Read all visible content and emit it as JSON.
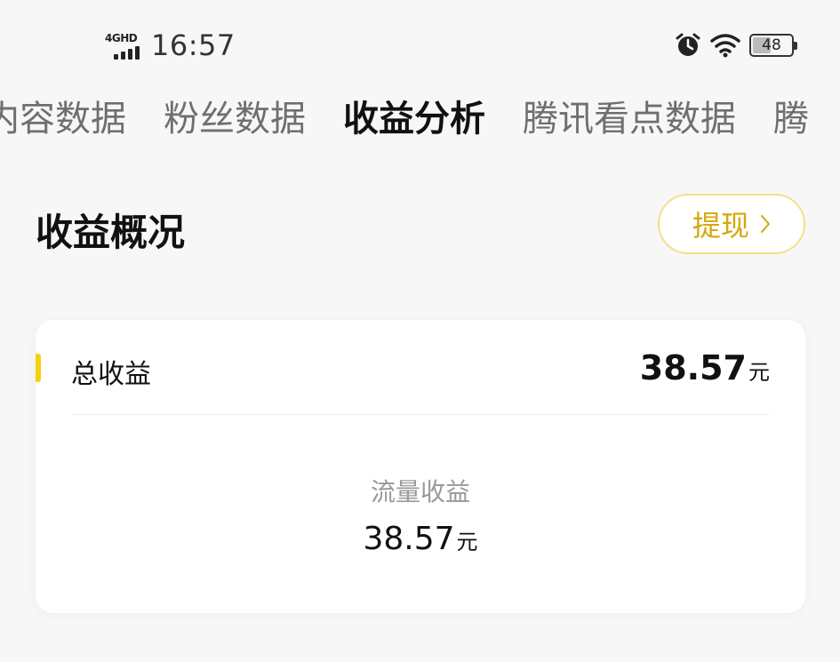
{
  "status_bar": {
    "network": "4GHD",
    "time": "16:57",
    "battery": "48",
    "battery_level": 0.48,
    "icons": [
      "signal-icon",
      "alarm-icon",
      "wifi-icon",
      "battery-icon"
    ]
  },
  "tabs": [
    {
      "label": "内容数据",
      "active": false
    },
    {
      "label": "粉丝数据",
      "active": false
    },
    {
      "label": "收益分析",
      "active": true
    },
    {
      "label": "腾讯看点数据",
      "active": false
    },
    {
      "label": "腾",
      "active": false
    }
  ],
  "section": {
    "title": "收益概况",
    "withdraw_label": "提现",
    "withdraw_icon": "chevron-right-icon"
  },
  "card": {
    "total_label": "总收益",
    "total_value": "38.57",
    "total_unit": "元",
    "sub_label": "流量收益",
    "sub_value": "38.57",
    "sub_unit": "元"
  },
  "colors": {
    "accent": "#f5d20a",
    "withdraw_text": "#d6a60a",
    "withdraw_border": "#f3e08a",
    "background": "#f7f7f7"
  }
}
